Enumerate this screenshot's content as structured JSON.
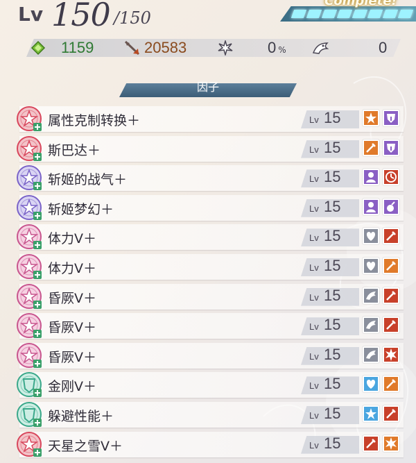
{
  "header": {
    "level_label": "Lv",
    "level_current": "150",
    "level_max": "/150",
    "complete_label": "Complete!",
    "gauge_segments": 8
  },
  "stats": {
    "hp": {
      "icon": "hp-diamond-icon",
      "value": "1159"
    },
    "attack": {
      "icon": "attack-arrow-icon",
      "value": "20583"
    },
    "critical": {
      "icon": "crit-burst-icon",
      "value": "0",
      "unit": "%"
    },
    "stun": {
      "icon": "stun-dragon-icon",
      "value": "0"
    }
  },
  "section_title": "因子",
  "factors": [
    {
      "name": "属性克制转换＋",
      "level_label": "Lv",
      "level": "15",
      "icon": "red-star-crest",
      "effects": [
        "star-up",
        "shield-debuff"
      ]
    },
    {
      "name": "斯巴达＋",
      "level_label": "Lv",
      "level": "15",
      "icon": "red-star-crest",
      "effects": [
        "sword-up",
        "defense-down"
      ]
    },
    {
      "name": "斩姬的战气＋",
      "level_label": "Lv",
      "level": "15",
      "icon": "purple-star-crest",
      "effects": [
        "bust-purple",
        "timer-red"
      ]
    },
    {
      "name": "斩姬梦幻＋",
      "level_label": "Lv",
      "level": "15",
      "icon": "purple-star-crest",
      "effects": [
        "bust-purple",
        "potion-purple"
      ]
    },
    {
      "name": "体力Ⅴ＋",
      "level_label": "Lv",
      "level": "15",
      "icon": "pink-star-crest",
      "effects": [
        "heart-gray",
        "sword-red"
      ]
    },
    {
      "name": "体力Ⅴ＋",
      "level_label": "Lv",
      "level": "15",
      "icon": "pink-star-crest",
      "effects": [
        "heart-gray",
        "sword-orange"
      ]
    },
    {
      "name": "昏厥Ⅴ＋",
      "level_label": "Lv",
      "level": "15",
      "icon": "pink-star-crest",
      "effects": [
        "stun-gray",
        "sword-red"
      ]
    },
    {
      "name": "昏厥Ⅴ＋",
      "level_label": "Lv",
      "level": "15",
      "icon": "pink-star-crest",
      "effects": [
        "stun-gray",
        "sword-red"
      ]
    },
    {
      "name": "昏厥Ⅴ＋",
      "level_label": "Lv",
      "level": "15",
      "icon": "pink-star-crest",
      "effects": [
        "stun-gray",
        "burst-red"
      ]
    },
    {
      "name": "金刚Ⅴ＋",
      "level_label": "Lv",
      "level": "15",
      "icon": "teal-shield-crest",
      "effects": [
        "heart-blue",
        "sword-orange"
      ]
    },
    {
      "name": "躲避性能＋",
      "level_label": "Lv",
      "level": "15",
      "icon": "teal-shield-crest",
      "effects": [
        "star-blue",
        "sword-red"
      ]
    },
    {
      "name": "天星之雪Ⅴ＋",
      "level_label": "Lv",
      "level": "15",
      "icon": "red-star-crest",
      "effects": [
        "sword-red",
        "burst-orange"
      ]
    }
  ],
  "colors": {
    "hp_green": "#2f7a33",
    "attack_brown": "#8a4b1e",
    "section_blue": "#3c5d77",
    "gauge_cyan": "#9ef3ff"
  }
}
